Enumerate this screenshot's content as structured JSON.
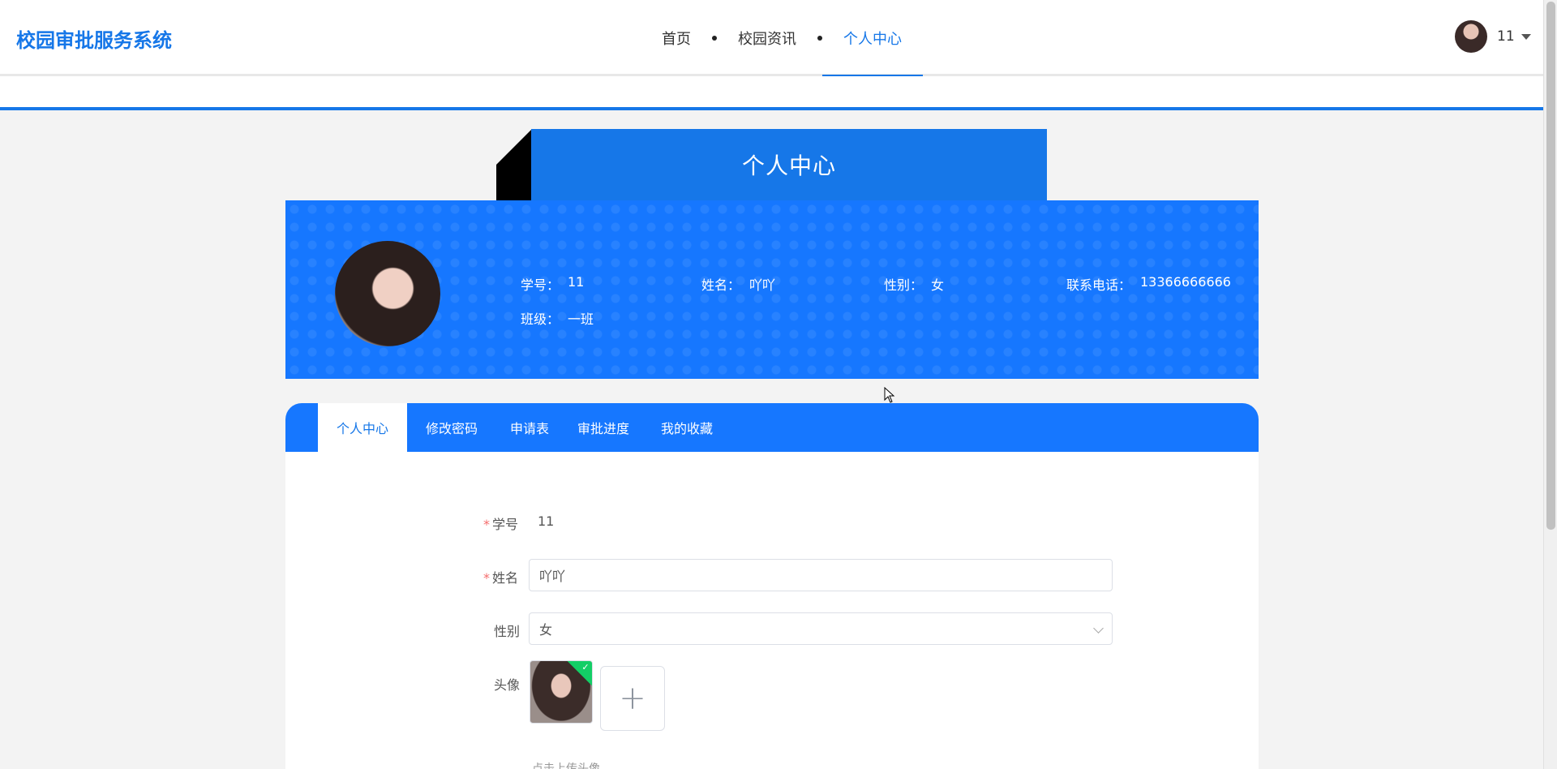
{
  "header": {
    "brand": "校园审批服务系统",
    "nav": [
      {
        "label": "首页"
      },
      {
        "label": "校园资讯"
      },
      {
        "label": "个人中心",
        "active": true
      }
    ],
    "user_name": "11"
  },
  "page_title": "个人中心",
  "profile": {
    "student_id_label": "学号：",
    "student_id": "11",
    "name_label": "姓名：",
    "name": "吖吖",
    "gender_label": "性别：",
    "gender": "女",
    "phone_label": "联系电话：",
    "phone": "13366666666",
    "class_label": "班级：",
    "class_name": "一班"
  },
  "tabs": [
    {
      "label": "个人中心",
      "active": true
    },
    {
      "label": "修改密码"
    },
    {
      "label": "申请表"
    },
    {
      "label": "审批进度"
    },
    {
      "label": "我的收藏"
    }
  ],
  "form": {
    "student_id_label": "学号",
    "student_id_value": "11",
    "name_label": "姓名",
    "name_value": "吖吖",
    "gender_label": "性别",
    "gender_value": "女",
    "avatar_label": "头像",
    "upload_plus": "+",
    "hint": "点击上传头像",
    "required_mark": "*"
  },
  "colors": {
    "accent": "#1677e8",
    "banner": "#1677ff",
    "success": "#13ce66"
  }
}
